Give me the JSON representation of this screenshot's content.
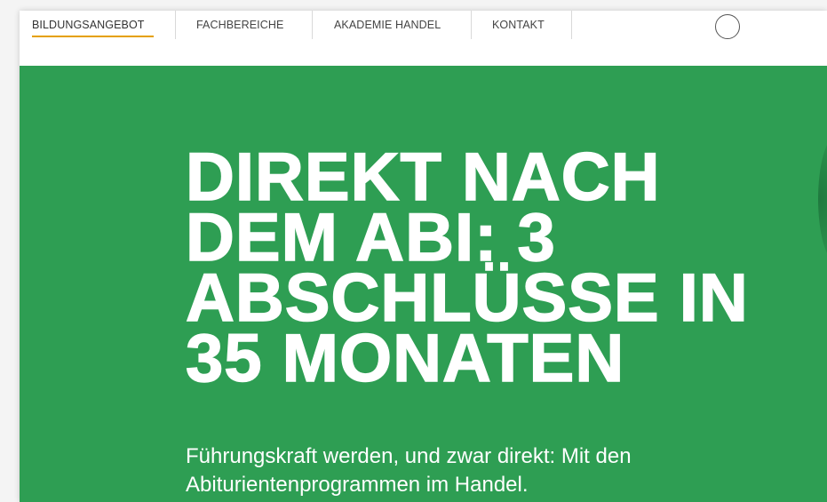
{
  "nav": {
    "items": [
      {
        "label": "BILDUNGSANGEBOT",
        "active": true
      },
      {
        "label": "FACHBEREICHE",
        "active": false
      },
      {
        "label": "AKADEMIE HANDEL",
        "active": false
      },
      {
        "label": "KONTAKT",
        "active": false
      }
    ],
    "active_color": "#e5a000",
    "search_icon": "search-circle-icon"
  },
  "hero": {
    "background_color": "#2e9e53",
    "headline_lines": [
      "DIREKT NACH",
      "DEM ABI: 3",
      "ABSCHLÜSSE IN",
      "35 MONATEN"
    ],
    "subline_lines": [
      "Führungskraft werden, und zwar direkt: Mit den",
      "Abiturientenprogrammen im Handel."
    ]
  }
}
